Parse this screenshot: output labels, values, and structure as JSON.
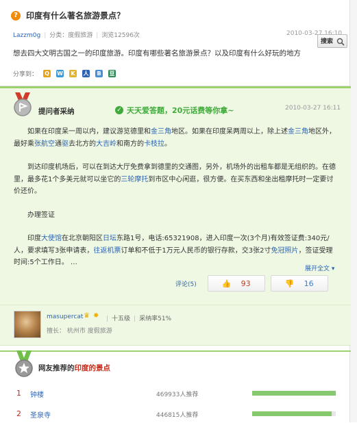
{
  "question": {
    "icon_glyph": "?",
    "title": "印度有什么著名旅游景点？",
    "asker": "Lazzm0g",
    "category_label": "分类：度假旅游",
    "views": "浏览12596次",
    "date": "2010-03-27 16:10",
    "body": "想去四大文明古国之一的印度旅游。印度有哪些著名旅游景点？以及印度有什么好玩的地方",
    "share_label": "分享到：",
    "share_icons": [
      "qzone-icon",
      "sina-weibo-icon",
      "kaixin-icon",
      "renren-icon",
      "baidu-icon",
      "douban-icon"
    ]
  },
  "search": {
    "label": "搜索"
  },
  "answer": {
    "badge_label": "提问者采纳",
    "promo": "天天爱答题，20元话费等你拿~",
    "date": "2010-03-27 16:11",
    "p1_a": "如果在印度呆一周以内，建议游览德里和",
    "p1_l1": "金三角",
    "p1_b": "地区。如果在印度呆两周以上，除上述",
    "p1_l2": "金三角",
    "p1_c": "地区外，最好乘",
    "p1_l3": "张航空",
    "p1_d": "通",
    "p1_l4": "驱",
    "p1_e": "去北方的",
    "p1_l5": "大吉岭",
    "p1_f": "和南方的",
    "p1_l6": "卡枝拉",
    "p1_g": "。",
    "p2_a": "到达印度机场后，可以在到达大厅免费拿到德里的交通图，另外，机场外的出租车都是无组织的。在德里，最多花1个多美元就可以坐它的",
    "p2_l1": "三轮摩托",
    "p2_b": "到市区中心闲逛，很方便。在买东西和坐出租摩托时一定要讨价还价。",
    "p3": "办理签证",
    "p4_a": "印度",
    "p4_l1": "大使馆",
    "p4_b": "在北京朝阳区",
    "p4_l2": "日坛",
    "p4_c": "东路1号，电话:65321908，进入印度一次(3个月)有效签证费:340元/人，要求填写3张申请表，",
    "p4_l3": "往返机票",
    "p4_d": "订单和不低于1万元人民币的银行存款，交3张2寸",
    "p4_l4": "免冠照片",
    "p4_e": "，签证受理时间:5个工作日。 …",
    "expand": "展开全文 ▾",
    "comments": "评论(5)",
    "upvotes": "93",
    "downvotes": "16"
  },
  "answerer": {
    "name": "masupercat",
    "level": "十五级",
    "accept_rate": "采纳率51%",
    "location_label": "擅长：",
    "location": "杭州市 度假旅游"
  },
  "recommendations": {
    "title_prefix": "网友推荐的",
    "title_em": "印度的景点",
    "items": [
      {
        "rank": "1",
        "name": "钟楼",
        "count": "469933人推荐",
        "share": 1.0
      },
      {
        "rank": "2",
        "name": "圣泉寺",
        "count": "446815人推荐",
        "share": 0.95
      }
    ]
  },
  "colors": {
    "accent_green": "#9bd26c",
    "link_blue": "#2d64b3",
    "rank_red": "#c4281c",
    "bar_green": "#86c96d"
  }
}
